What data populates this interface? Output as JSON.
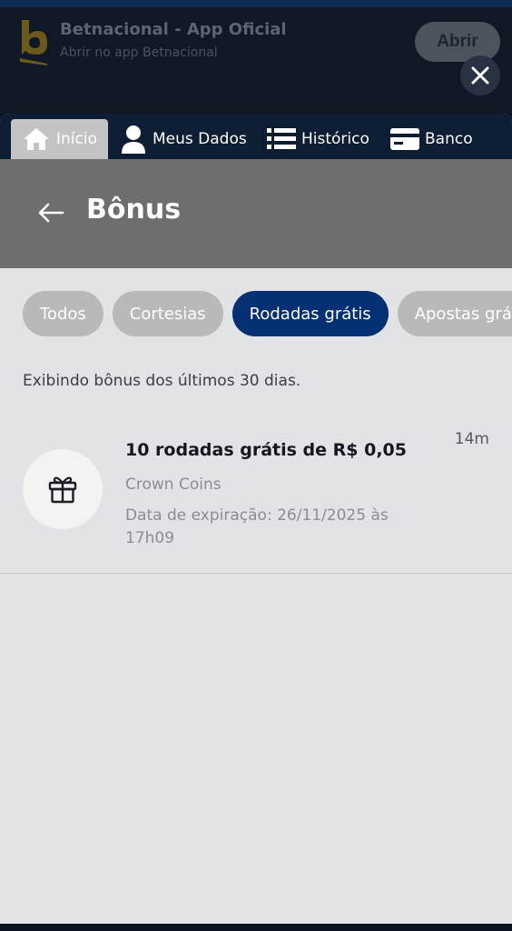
{
  "banner": {
    "title": "Betnacional - App Oficial",
    "subtitle": "Abrir no app Betnacional",
    "open_label": "Abrir",
    "logo_icon": "betnacional-logo",
    "logo_color": "#6b5a1d"
  },
  "close_icon": "close-icon",
  "nav": {
    "items": [
      {
        "label": "Início",
        "icon": "home-icon",
        "active": true
      },
      {
        "label": "Meus Dados",
        "icon": "user-icon",
        "active": false
      },
      {
        "label": "Histórico",
        "icon": "list-icon",
        "active": false
      },
      {
        "label": "Banco",
        "icon": "card-icon",
        "active": false
      }
    ]
  },
  "header": {
    "title": "Bônus",
    "back_icon": "arrow-left-icon"
  },
  "filters": {
    "chips": [
      {
        "label": "Todos",
        "active": false
      },
      {
        "label": "Cortesias",
        "active": false
      },
      {
        "label": "Rodadas grátis",
        "active": true
      },
      {
        "label": "Apostas grátis",
        "active": false
      }
    ]
  },
  "info_text": "Exibindo bônus dos últimos 30 dias.",
  "bonus_items": [
    {
      "icon": "gift-icon",
      "title": "10 rodadas grátis de R$ 0,05",
      "provider": "Crown Coins",
      "expiry": "Data de expiração: 26/11/2025 às 17h09",
      "time": "14m"
    }
  ],
  "colors": {
    "accent": "#053074",
    "nav_bg": "#0d1d33",
    "header_bg": "#6d6e70",
    "chip_bg": "#b8b9bb"
  }
}
